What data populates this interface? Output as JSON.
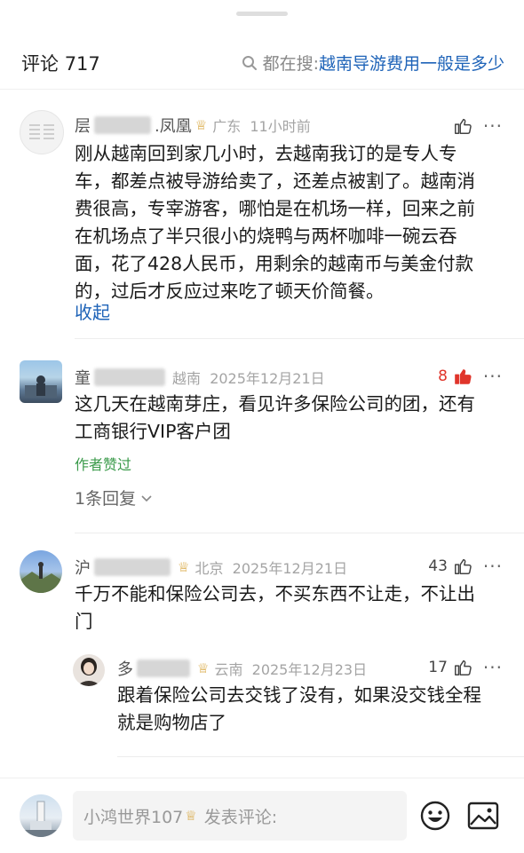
{
  "header": {
    "comment_label": "评论",
    "comment_count": "717",
    "search_prefix": "都在搜:",
    "search_query": "越南导游费用一般是多少"
  },
  "comments": [
    {
      "name_start": "层",
      "name_end": ".凤凰",
      "crown": "♕",
      "location": "广东",
      "time": "11小时前",
      "text_lines": [
        "刚从越南回到家几小时，去越南我订的是专人专",
        "车，都差点被导游给卖了，还差点被割了。越南消",
        "费很高，专宰游客，哪怕是在机场一样，回来之前",
        "在机场点了半只很小的烧鸭与两杯咖啡一碗云吞",
        "面，花了428人民币，用剩余的越南币与美金付款",
        "的，过后才反应过来吃了顿天价简餐。"
      ],
      "collapse_label": "收起"
    },
    {
      "name_start": "童",
      "location": "越南",
      "time": "2025年12月21日",
      "likes": "8",
      "text_lines": [
        "这几天在越南芽庄，看见许多保险公司的团，还有",
        "工商银行VIP客户团"
      ],
      "author_liked": "作者赞过",
      "replies_label": "1条回复"
    },
    {
      "name_start": "沪",
      "crown": "♕",
      "location": "北京",
      "time": "2025年12月21日",
      "likes": "43",
      "text_lines": [
        "千万不能和保险公司去，不买东西不让走，不让出",
        "门"
      ]
    },
    {
      "name_start": "多",
      "crown": "♕",
      "location": "云南",
      "time": "2025年12月23日",
      "likes": "17",
      "text_lines": [
        "跟着保险公司去交钱了没有，如果没交钱全程",
        "就是购物店了"
      ]
    }
  ],
  "composer": {
    "username": "小鸿世界107",
    "crown": "♕",
    "placeholder": "发表评论:"
  },
  "colors": {
    "link_blue": "#1e63b8",
    "like_red": "#e0352b",
    "liked_green": "#3a9a4a",
    "crown_gold": "#d6a235"
  },
  "icons": [
    "search-icon",
    "thumbs-up-icon",
    "more-icon",
    "chevron-down-icon",
    "emoji-icon",
    "image-icon",
    "crown-icon"
  ]
}
